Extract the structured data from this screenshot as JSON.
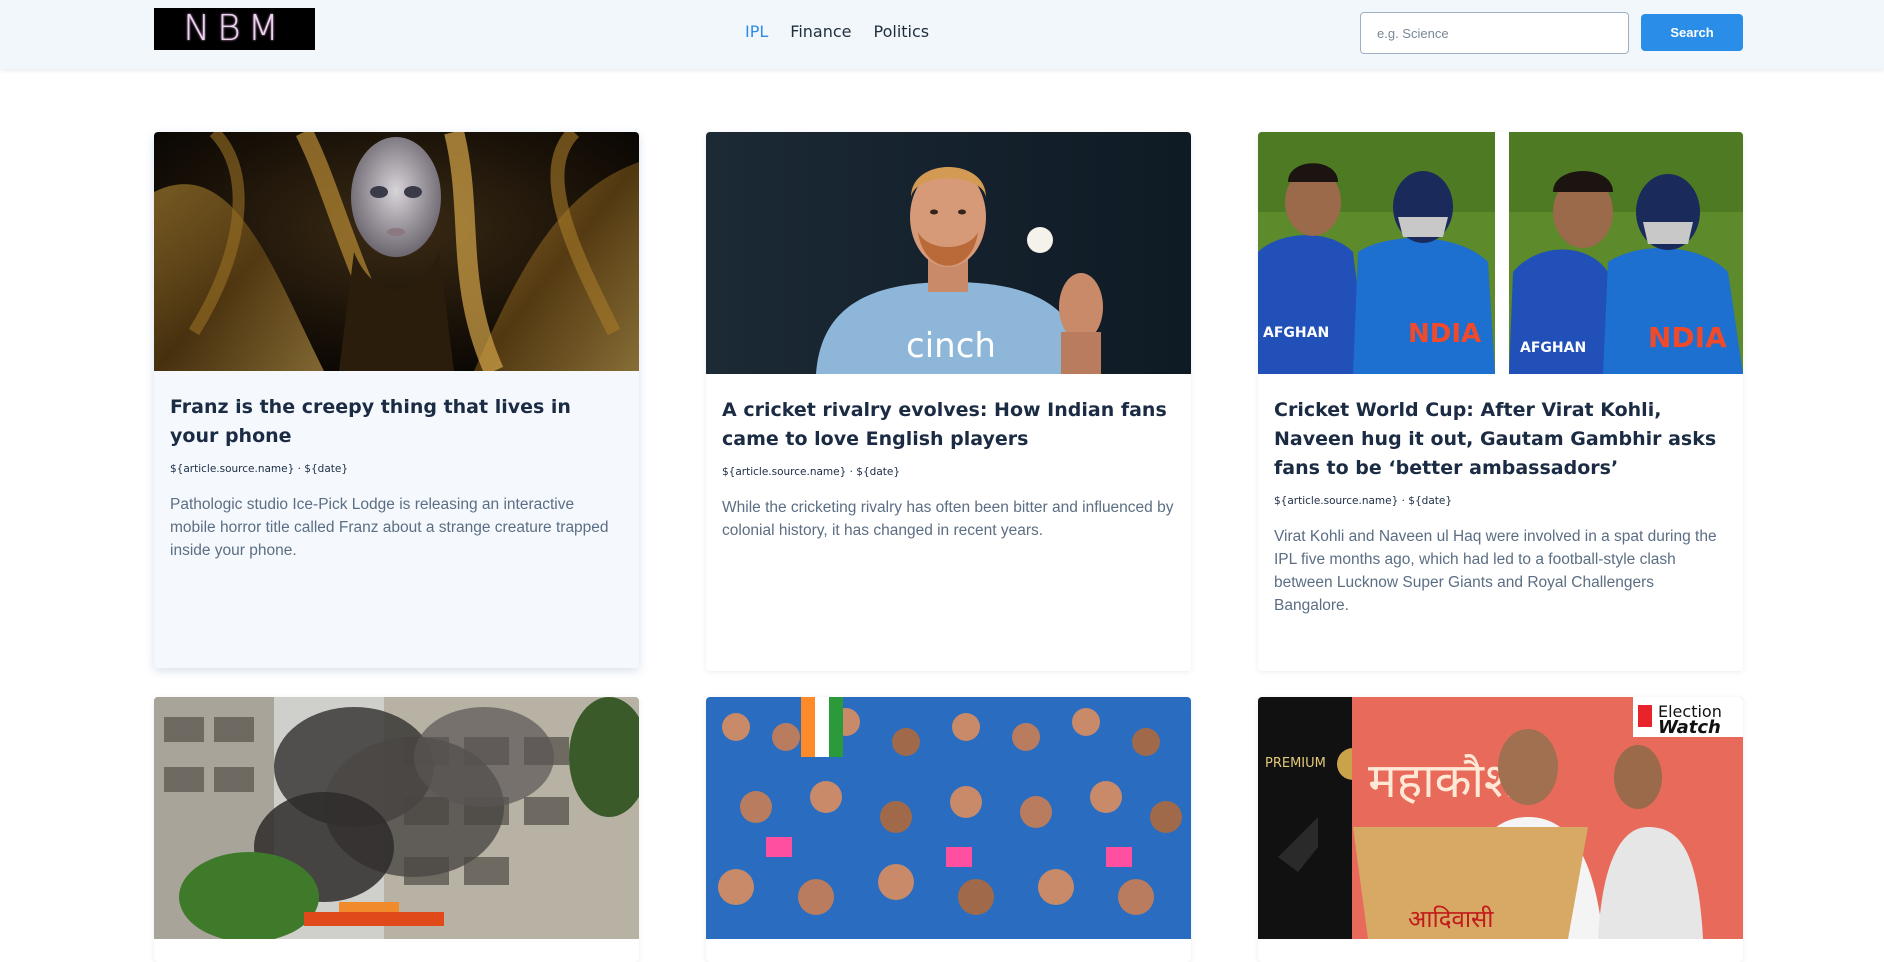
{
  "header": {
    "logo": "NBM",
    "nav": [
      {
        "label": "IPL",
        "active": true
      },
      {
        "label": "Finance",
        "active": false
      },
      {
        "label": "Politics",
        "active": false
      }
    ],
    "search": {
      "placeholder": "e.g. Science",
      "button_label": "Search"
    }
  },
  "articles": [
    {
      "title": "Franz is the creepy thing that lives in your phone",
      "meta": "${article.source.name} · ${date}",
      "description": "Pathologic studio Ice-Pick Lodge is releasing an interactive mobile horror title called Franz about a strange creature trapped inside your phone."
    },
    {
      "title": "A cricket rivalry evolves: How Indian fans came to love English players",
      "meta": "${article.source.name} · ${date}",
      "description": "While the cricketing rivalry has often been bitter and influenced by colonial history, it has changed in recent years."
    },
    {
      "title": "Cricket World Cup: After Virat Kohli, Naveen hug it out, Gautam Gambhir asks fans to be ‘better ambassadors’",
      "meta": "${article.source.name} · ${date}",
      "description": "Virat Kohli and Naveen ul Haq were involved in a spat during the IPL five months ago, which had led to a football-style clash between Lucknow Super Giants and Royal Challengers Bangalore."
    }
  ],
  "image_text": {
    "jersey_sponsor": "cinch",
    "jersey_left": "AFGHAN",
    "jersey_right": "NDIA",
    "premium": "PREMIUM",
    "election_1": "Election",
    "election_2": "Watch",
    "banner_hindi": "महाकौशल",
    "podium_hindi": "आदिवासी"
  },
  "colors": {
    "accent": "#2a8ee8",
    "nav_bg": "#f2f7fc",
    "title": "#1b2b44",
    "body_text": "#5b6e83"
  }
}
